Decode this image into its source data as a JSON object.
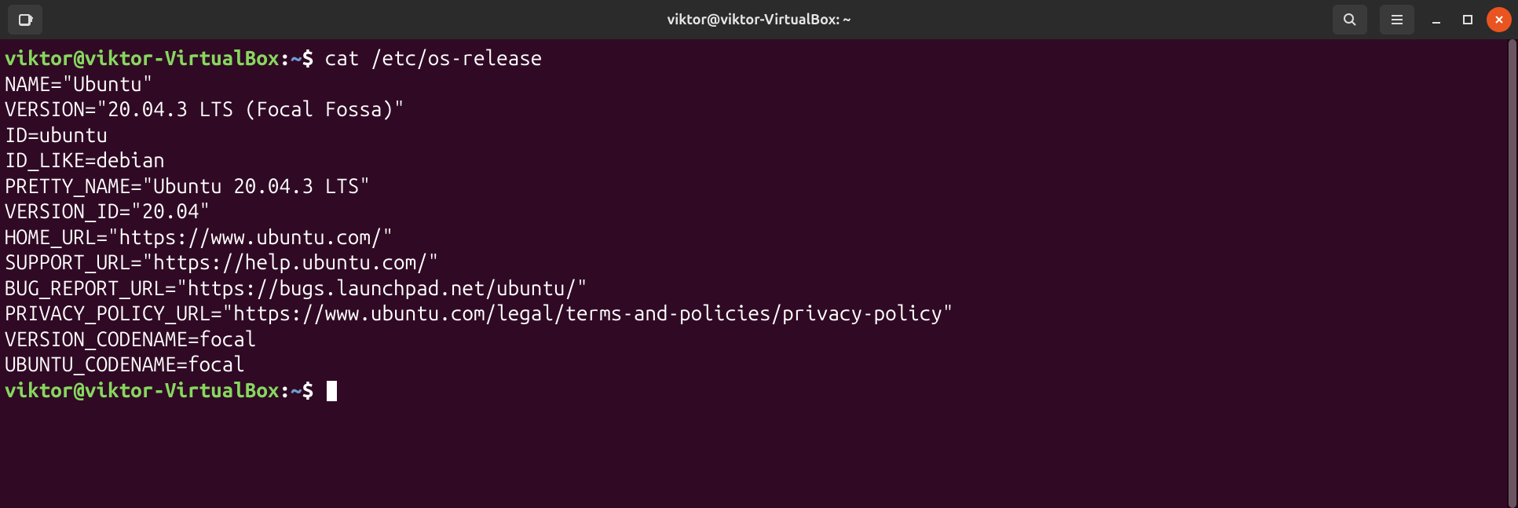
{
  "titlebar": {
    "title": "viktor@viktor-VirtualBox: ~"
  },
  "prompt": {
    "user_host": "viktor@viktor-VirtualBox",
    "sep": ":",
    "path": "~",
    "symbol": "$"
  },
  "command": "cat /etc/os-release",
  "output": [
    "NAME=\"Ubuntu\"",
    "VERSION=\"20.04.3 LTS (Focal Fossa)\"",
    "ID=ubuntu",
    "ID_LIKE=debian",
    "PRETTY_NAME=\"Ubuntu 20.04.3 LTS\"",
    "VERSION_ID=\"20.04\"",
    "HOME_URL=\"https://www.ubuntu.com/\"",
    "SUPPORT_URL=\"https://help.ubuntu.com/\"",
    "BUG_REPORT_URL=\"https://bugs.launchpad.net/ubuntu/\"",
    "PRIVACY_POLICY_URL=\"https://www.ubuntu.com/legal/terms-and-policies/privacy-policy\"",
    "VERSION_CODENAME=focal",
    "UBUNTU_CODENAME=focal"
  ]
}
